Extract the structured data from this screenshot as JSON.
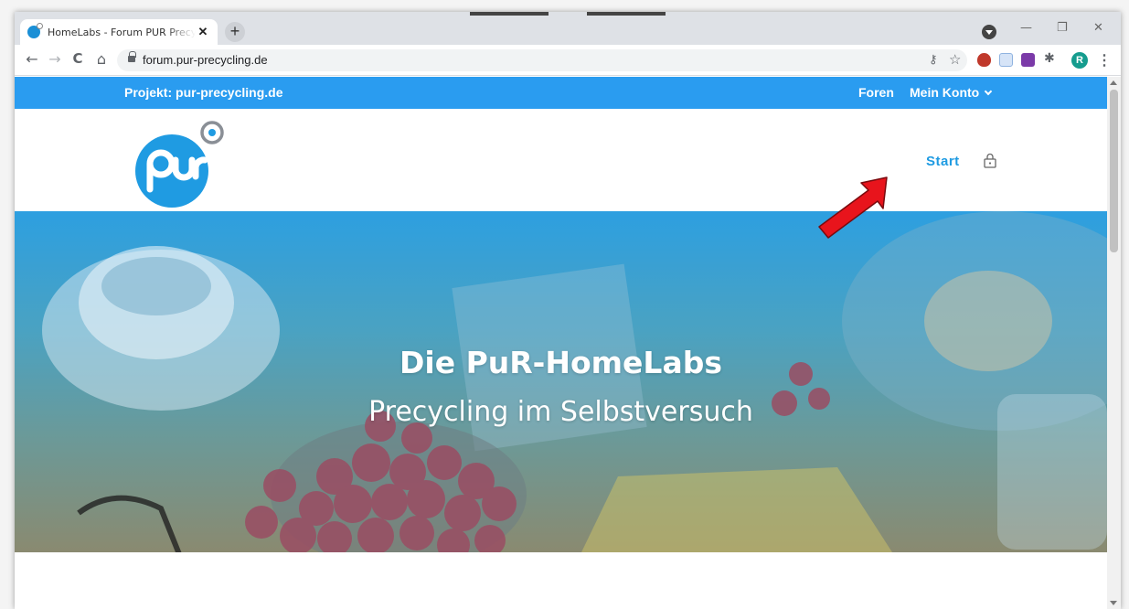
{
  "browser": {
    "tab_title": "HomeLabs - Forum PUR Precycling",
    "tab_close": "✕",
    "new_tab": "+",
    "url": "forum.pur-precycling.de",
    "avatar_letter": "R",
    "window_controls": {
      "minimize": "—",
      "restore": "❐",
      "close": "✕"
    },
    "nav": {
      "back": "←",
      "forward": "→",
      "reload": "C",
      "home": "⌂"
    },
    "omnibox_icons": {
      "key": "⚷",
      "star": "☆"
    },
    "menu": "⋮"
  },
  "site": {
    "project_link": "Projekt: pur-precycling.de",
    "nav_foren": "Foren",
    "nav_konto": "Mein Konto",
    "start_link": "Start",
    "hero_title": "Die PuR-HomeLabs",
    "hero_subtitle": "Precycling im Selbstversuch"
  },
  "colors": {
    "topbar": "#2a9cf0",
    "accent": "#1f9be2",
    "arrow": "#e8141c"
  },
  "icons": {
    "logo": "pur-logo",
    "lock": "lock-icon",
    "arrow": "red-arrow-annotation"
  }
}
